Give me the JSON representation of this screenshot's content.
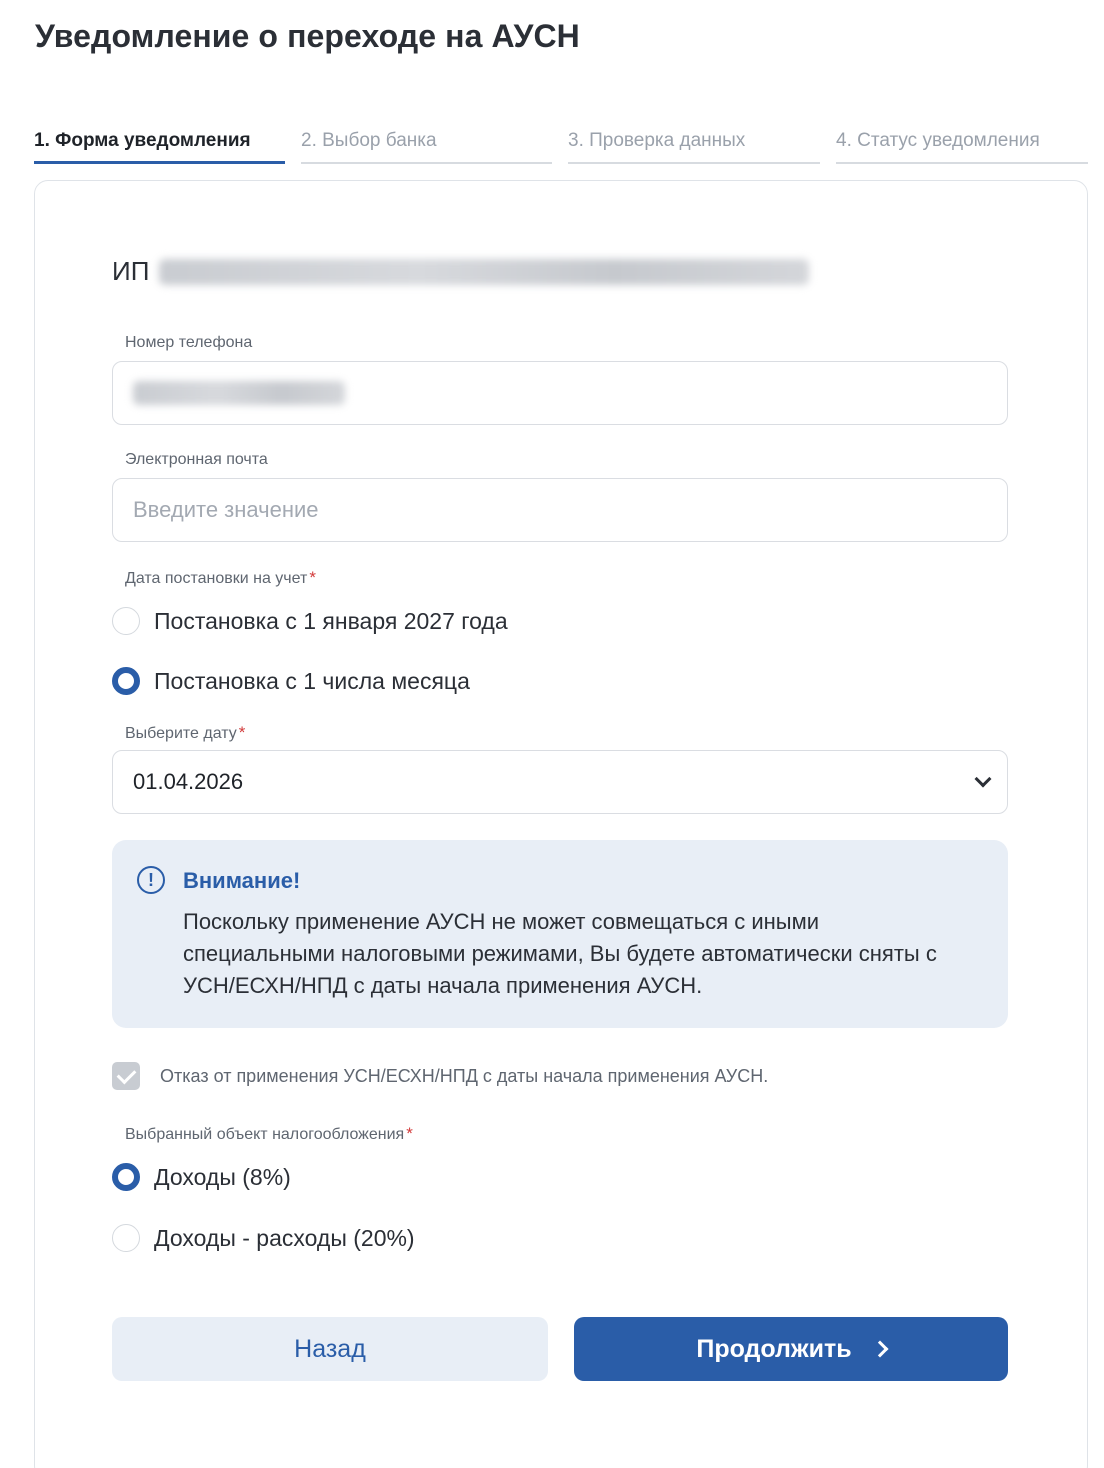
{
  "page": {
    "title": "Уведомление о переходе на АУСН"
  },
  "steps": [
    {
      "label": "1. Форма уведомления",
      "active": true
    },
    {
      "label": "2. Выбор банка",
      "active": false
    },
    {
      "label": "3. Проверка данных",
      "active": false
    },
    {
      "label": "4. Статус уведомления",
      "active": false
    }
  ],
  "form": {
    "ip_prefix": "ИП",
    "phone": {
      "label": "Номер телефона"
    },
    "email": {
      "label": "Электронная почта",
      "placeholder": "Введите значение"
    },
    "registration_date": {
      "label": "Дата постановки на учет",
      "required_mark": "*",
      "options": [
        {
          "label": "Постановка с 1 января 2027 года",
          "selected": false
        },
        {
          "label": "Постановка с 1 числа месяца",
          "selected": true
        }
      ]
    },
    "date_select": {
      "label": "Выберите дату",
      "required_mark": "*",
      "value": "01.04.2026"
    },
    "alert": {
      "title": "Внимание!",
      "icon": "!",
      "text": "Поскольку применение АУСН не может совмещаться с иными специальными налоговыми режимами, Вы будете автоматически сняты с УСН/ЕСХН/НПД с даты начала применения АУСН."
    },
    "refusal_checkbox": {
      "label": "Отказ от применения УСН/ЕСХН/НПД с даты начала применения АУСН.",
      "checked": true
    },
    "tax_object": {
      "label": "Выбранный объект налогообложения",
      "required_mark": "*",
      "options": [
        {
          "label": "Доходы (8%)",
          "selected": true
        },
        {
          "label": "Доходы - расходы (20%)",
          "selected": false
        }
      ]
    }
  },
  "buttons": {
    "back": "Назад",
    "next": "Продолжить"
  },
  "colors": {
    "accent": "#2a5da8",
    "alert_bg": "#e8eef6",
    "required": "#d23a3a"
  }
}
